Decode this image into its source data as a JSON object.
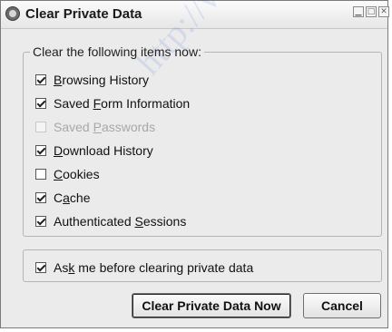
{
  "window": {
    "title": "Clear Private Data",
    "controls": [
      "minimize",
      "maximize",
      "close"
    ]
  },
  "group": {
    "legend": "Clear the following items now:",
    "items": [
      {
        "pre": "",
        "key": "B",
        "post": "rowsing History",
        "checked": true,
        "enabled": true
      },
      {
        "pre": "Saved ",
        "key": "F",
        "post": "orm Information",
        "checked": true,
        "enabled": true
      },
      {
        "pre": "Saved ",
        "key": "P",
        "post": "asswords",
        "checked": false,
        "enabled": false
      },
      {
        "pre": "",
        "key": "D",
        "post": "ownload History",
        "checked": true,
        "enabled": true
      },
      {
        "pre": "",
        "key": "C",
        "post": "ookies",
        "checked": false,
        "enabled": true
      },
      {
        "pre": "C",
        "key": "a",
        "post": "che",
        "checked": true,
        "enabled": true
      },
      {
        "pre": "Authenticated ",
        "key": "S",
        "post": "essions",
        "checked": true,
        "enabled": true
      }
    ]
  },
  "ask": {
    "pre": "As",
    "key": "k",
    "post": " me before clearing private data",
    "checked": true
  },
  "buttons": {
    "clear_now": "Clear Private Data Now",
    "cancel": "Cancel"
  },
  "watermark": "http://w"
}
